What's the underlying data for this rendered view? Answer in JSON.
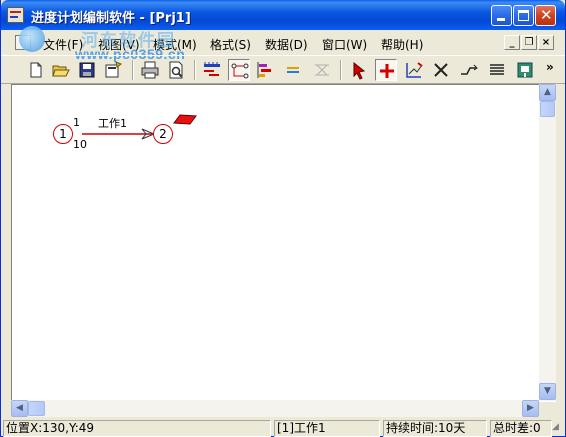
{
  "window": {
    "title": "进度计划编制软件 - [Prj1]"
  },
  "watermark": {
    "name": "河东软件园",
    "site": "www.pc0359.cn"
  },
  "menu": {
    "items": [
      "文件(F)",
      "视图(V)",
      "模式(M)",
      "格式(S)",
      "数据(D)",
      "窗口(W)",
      "帮助(H)"
    ]
  },
  "toolbar": {
    "overflow_label": "»",
    "tools": [
      "new-icon",
      "open-icon",
      "save-icon",
      "save-as-icon",
      "print-icon",
      "print-preview-icon",
      "timeline-icon",
      "network-icon",
      "gantt-icon",
      "align-icon",
      "resource-icon",
      "pointer-icon",
      "add-node-icon",
      "draw-icon",
      "delete-icon",
      "link-icon",
      "list-icon",
      "export-icon"
    ]
  },
  "diagram": {
    "node_start": "1",
    "node_end": "2",
    "work_id": "1",
    "work_name": "工作1",
    "duration": "10",
    "link_color": "#d40000",
    "flag_color": "#e81010"
  },
  "status": {
    "position": "位置X:130,Y:49",
    "selection": "[1]工作1",
    "duration": "持续时间:10天",
    "total_float": "总时差:0"
  }
}
